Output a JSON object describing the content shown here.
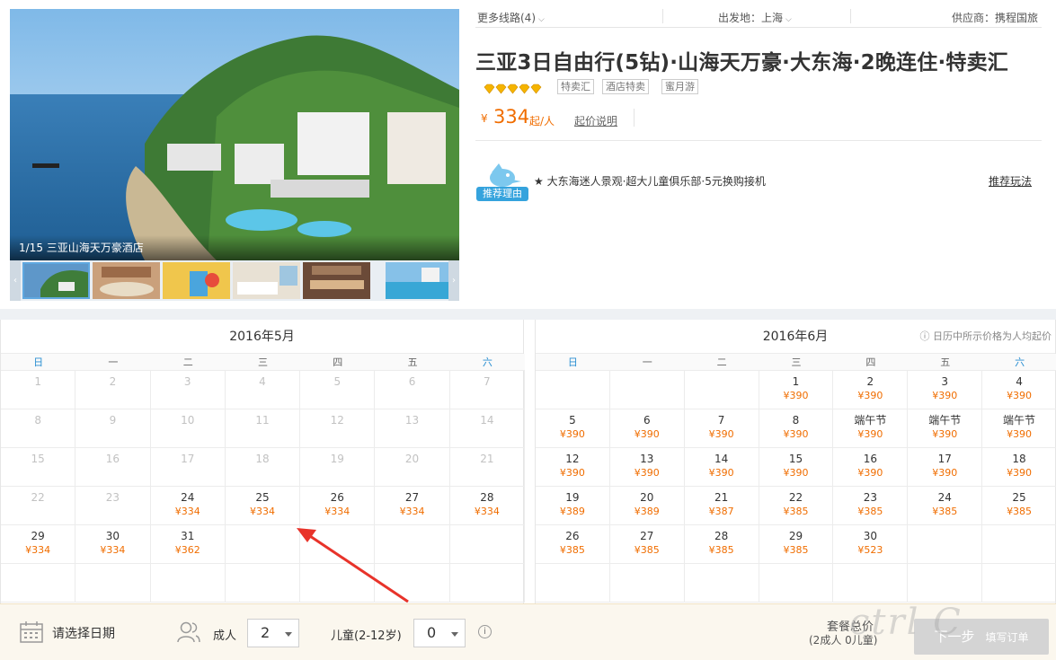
{
  "gallery": {
    "caption": "1/15  三亚山海天万豪酒店",
    "prev_arrow": "‹",
    "next_arrow": "›"
  },
  "info_bar": {
    "more_routes": "更多线路(4)",
    "departure": "出发地：上海",
    "supplier": "供应商：携程国旅"
  },
  "product": {
    "title": "三亚3日自由行(5钻)·山海天万豪·大东海·2晚连住·特卖汇",
    "diamond_rating": 5,
    "tags": [
      "特卖汇",
      "酒店特卖",
      "蜜月游"
    ],
    "price_symbol": "¥",
    "price": "334",
    "price_unit": "起/人",
    "price_note": "起价说明"
  },
  "recommend": {
    "badge_label": "推荐理由",
    "text": "★ 大东海迷人景观·超大儿童俱乐部·5元换购接机",
    "link": "推荐玩法"
  },
  "calendar": {
    "weekdays": [
      "日",
      "一",
      "二",
      "三",
      "四",
      "五",
      "六"
    ],
    "note": "ⓘ 日历中所示价格为人均起价",
    "months": [
      {
        "title": "2016年5月",
        "rows": [
          [
            {
              "d": "1",
              "p": "",
              "past": true
            },
            {
              "d": "2",
              "p": "",
              "past": true
            },
            {
              "d": "3",
              "p": "",
              "past": true
            },
            {
              "d": "4",
              "p": "",
              "past": true
            },
            {
              "d": "5",
              "p": "",
              "past": true
            },
            {
              "d": "6",
              "p": "",
              "past": true
            },
            {
              "d": "7",
              "p": "",
              "past": true
            }
          ],
          [
            {
              "d": "8",
              "p": "",
              "past": true
            },
            {
              "d": "9",
              "p": "",
              "past": true
            },
            {
              "d": "10",
              "p": "",
              "past": true
            },
            {
              "d": "11",
              "p": "",
              "past": true
            },
            {
              "d": "12",
              "p": "",
              "past": true
            },
            {
              "d": "13",
              "p": "",
              "past": true
            },
            {
              "d": "14",
              "p": "",
              "past": true
            }
          ],
          [
            {
              "d": "15",
              "p": "",
              "past": true
            },
            {
              "d": "16",
              "p": "",
              "past": true
            },
            {
              "d": "17",
              "p": "",
              "past": true
            },
            {
              "d": "18",
              "p": "",
              "past": true
            },
            {
              "d": "19",
              "p": "",
              "past": true
            },
            {
              "d": "20",
              "p": "",
              "past": true
            },
            {
              "d": "21",
              "p": "",
              "past": true
            }
          ],
          [
            {
              "d": "22",
              "p": "",
              "past": true
            },
            {
              "d": "23",
              "p": "",
              "past": true
            },
            {
              "d": "24",
              "p": "¥334"
            },
            {
              "d": "25",
              "p": "¥334"
            },
            {
              "d": "26",
              "p": "¥334"
            },
            {
              "d": "27",
              "p": "¥334"
            },
            {
              "d": "28",
              "p": "¥334"
            }
          ],
          [
            {
              "d": "29",
              "p": "¥334"
            },
            {
              "d": "30",
              "p": "¥334"
            },
            {
              "d": "31",
              "p": "¥362"
            },
            {
              "d": "",
              "p": ""
            },
            {
              "d": "",
              "p": ""
            },
            {
              "d": "",
              "p": ""
            },
            {
              "d": "",
              "p": ""
            }
          ],
          [
            {
              "d": "",
              "p": ""
            },
            {
              "d": "",
              "p": ""
            },
            {
              "d": "",
              "p": ""
            },
            {
              "d": "",
              "p": ""
            },
            {
              "d": "",
              "p": ""
            },
            {
              "d": "",
              "p": ""
            },
            {
              "d": "",
              "p": ""
            }
          ]
        ]
      },
      {
        "title": "2016年6月",
        "rows": [
          [
            {
              "d": "",
              "p": ""
            },
            {
              "d": "",
              "p": ""
            },
            {
              "d": "",
              "p": ""
            },
            {
              "d": "1",
              "p": "¥390"
            },
            {
              "d": "2",
              "p": "¥390"
            },
            {
              "d": "3",
              "p": "¥390"
            },
            {
              "d": "4",
              "p": "¥390"
            }
          ],
          [
            {
              "d": "5",
              "p": "¥390"
            },
            {
              "d": "6",
              "p": "¥390"
            },
            {
              "d": "7",
              "p": "¥390"
            },
            {
              "d": "8",
              "p": "¥390"
            },
            {
              "d": "端午节",
              "p": "¥390"
            },
            {
              "d": "端午节",
              "p": "¥390"
            },
            {
              "d": "端午节",
              "p": "¥390"
            }
          ],
          [
            {
              "d": "12",
              "p": "¥390"
            },
            {
              "d": "13",
              "p": "¥390"
            },
            {
              "d": "14",
              "p": "¥390"
            },
            {
              "d": "15",
              "p": "¥390"
            },
            {
              "d": "16",
              "p": "¥390"
            },
            {
              "d": "17",
              "p": "¥390"
            },
            {
              "d": "18",
              "p": "¥390"
            }
          ],
          [
            {
              "d": "19",
              "p": "¥389"
            },
            {
              "d": "20",
              "p": "¥389"
            },
            {
              "d": "21",
              "p": "¥387"
            },
            {
              "d": "22",
              "p": "¥385"
            },
            {
              "d": "23",
              "p": "¥385"
            },
            {
              "d": "24",
              "p": "¥385"
            },
            {
              "d": "25",
              "p": "¥385"
            }
          ],
          [
            {
              "d": "26",
              "p": "¥385"
            },
            {
              "d": "27",
              "p": "¥385"
            },
            {
              "d": "28",
              "p": "¥385"
            },
            {
              "d": "29",
              "p": "¥385"
            },
            {
              "d": "30",
              "p": "¥523"
            },
            {
              "d": "",
              "p": ""
            },
            {
              "d": "",
              "p": ""
            }
          ],
          [
            {
              "d": "",
              "p": ""
            },
            {
              "d": "",
              "p": ""
            },
            {
              "d": "",
              "p": ""
            },
            {
              "d": "",
              "p": ""
            },
            {
              "d": "",
              "p": ""
            },
            {
              "d": "",
              "p": ""
            },
            {
              "d": "",
              "p": ""
            }
          ]
        ]
      }
    ]
  },
  "bottom_bar": {
    "select_date": "请选择日期",
    "adult_label": "成人",
    "adult_value": "2",
    "child_label": "儿童(2-12岁)",
    "child_value": "0",
    "total_label": "套餐总价",
    "total_sub": "(2成人 0儿童)",
    "next_label": "下一步",
    "next_sub": "填写订单"
  },
  "colors": {
    "price": "#f06d00",
    "weekend": "#2a8fd2",
    "badge": "#35a3dd",
    "annotation_arrow": "#e8332a"
  }
}
